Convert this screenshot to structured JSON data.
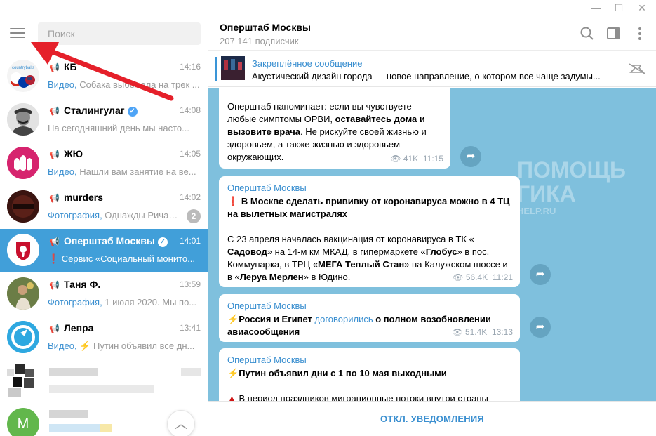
{
  "window": {
    "minimize_glyph": "—",
    "maximize_glyph": "☐",
    "close_glyph": "✕"
  },
  "sidebar": {
    "search_placeholder": "Поиск",
    "chats": [
      {
        "name": "КБ",
        "time": "14:16",
        "kind": "Видео,",
        "preview": " Собака выбежала на трек ..."
      },
      {
        "name": "Сталингулаг",
        "time": "14:08",
        "kind": "",
        "preview": "На сегодняшний день мы насто..."
      },
      {
        "name": "ЖЮ",
        "time": "14:05",
        "kind": "Видео,",
        "preview": " Нашли вам занятие на ве..."
      },
      {
        "name": "murders",
        "time": "14:02",
        "kind": "Фотография,",
        "preview": " Однажды Ричар...",
        "badge": "2"
      },
      {
        "name": "Оперштаб Москвы",
        "time": "14:01",
        "kind": "",
        "preview": "❗ Сервис «Социальный монито..."
      },
      {
        "name": "Таня Ф.",
        "time": "13:59",
        "kind": "Фотография,",
        "preview": " 1 июля 2020. Мы по..."
      },
      {
        "name": "Лепра",
        "time": "13:41",
        "kind": "Видео,",
        "preview": " ⚡ Путин объявил все дн..."
      }
    ],
    "last_avatar_letter": "M",
    "avatar_kb_text": "countryballs"
  },
  "header": {
    "title": "Оперштаб Москвы",
    "subscribers": "207 141 подписчик"
  },
  "pinned": {
    "title": "Закреплённое сообщение",
    "text": "Акустический дизайн города — новое направление, о котором все чаще задумы..."
  },
  "messages": {
    "m1": {
      "line1": "Оперштаб напоминает: если вы чувствуете",
      "line2a": "любые симптомы ОРВИ, ",
      "line2b": "оставайтесь дома и",
      "line3b": "вызовите врача",
      "line3c": ". Не рискуйте своей жизнью и",
      "line4": "здоровьем, а также жизнью и здоровьем",
      "line5": "окружающих.",
      "views": "41K",
      "time": "11:15"
    },
    "m2": {
      "from": "Оперштаб Москвы",
      "headline1": "В Москве сделать прививку от коронавируса можно в 4 ТЦ",
      "headline2": "на вылетных магистралях",
      "p1": "С 23 апреля началась вакцинация от коронавируса в ТК «",
      "p2a": "Садовод",
      "p2b": "» на 14-м км МКАД, в гипермаркете «",
      "p2c": "Глобус",
      "p2d": "» в пос.",
      "p3a": "Коммунарка, в ТРЦ «",
      "p3b": "МЕГА Теплый Стан",
      "p3c": "» на Калужском шоссе и",
      "p4a": "в «",
      "p4b": "Леруа Мерлен",
      "p4c": "» в Юдино.",
      "views": "56.4K",
      "time": "11:21"
    },
    "m3": {
      "from": "Оперштаб Москвы",
      "a": "Россия и Египет ",
      "link": "договорились",
      "b": " о полном возобновлении",
      "c": "авиасообщения",
      "views": "51.4K",
      "time": "13:13"
    },
    "m4": {
      "from": "Оперштаб Москвы",
      "headline": "Путин объявил дни с 1 по 10 мая выходными",
      "p1": "В период праздников миграционные потоки внутри страны"
    }
  },
  "watermark": {
    "line1": "ПОМОЩЬ",
    "line2": "ГИКА",
    "line3": "HELP.RU"
  },
  "bottom": {
    "action": "ОТКЛ. УВЕДОМЛЕНИЯ"
  },
  "colors": {
    "accent": "#419fd9",
    "link": "#3a8fd0",
    "chat_bg": "#7fc0dd",
    "arrow": "#e5202a"
  }
}
